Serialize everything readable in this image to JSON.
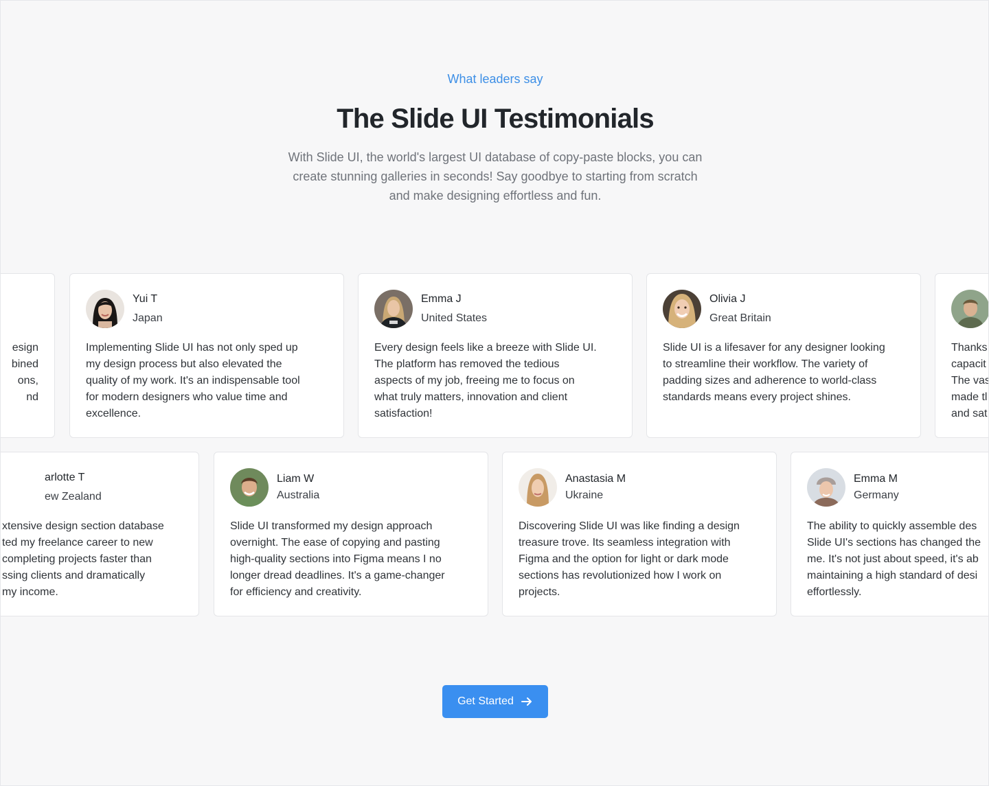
{
  "header": {
    "eyebrow": "What leaders say",
    "title": "The Slide UI Testimonials",
    "subtitle_lines": [
      "With Slide UI, the world's largest UI database of copy-paste blocks, you can",
      "create stunning galleries in seconds! Say goodbye to starting from scratch",
      "and make designing effortless and fun."
    ]
  },
  "row1": [
    {
      "name": "",
      "location": "",
      "avatar": "hidden",
      "lines": [
        "esign",
        "bined",
        "ons,",
        "nd"
      ]
    },
    {
      "name": "Yui T",
      "location": "Japan",
      "avatar": "woman-dark-hair",
      "lines": [
        "Implementing Slide UI has not only sped up",
        "my design process but also elevated the",
        "quality of my work. It's an indispensable tool",
        "for modern designers who value time and",
        "excellence."
      ]
    },
    {
      "name": "Emma J",
      "location": "United States",
      "avatar": "woman-blonde-tshirt",
      "lines": [
        "Every design feels like a breeze with Slide UI.",
        "The platform has removed the tedious",
        "aspects of my job, freeing me to focus on",
        "what truly matters, innovation and client",
        "satisfaction!"
      ]
    },
    {
      "name": "Olivia J",
      "location": "Great Britain",
      "avatar": "woman-blonde-smiling",
      "lines": [
        "Slide UI is a lifesaver for any designer looking",
        "to streamline their workflow. The variety of",
        "padding sizes and adherence to world-class",
        "standards means every project shines."
      ]
    },
    {
      "name": "",
      "location": "",
      "avatar": "man-outdoor",
      "lines": [
        "Thanks",
        "capacit",
        "The vas",
        "made tl",
        "and sat"
      ]
    }
  ],
  "row2": [
    {
      "name": "arlotte T",
      "location": "ew Zealand",
      "avatar": "hidden",
      "lines": [
        "xtensive design section database",
        "ted my freelance career to new",
        " completing projects faster than",
        "ssing clients and dramatically",
        "my income."
      ]
    },
    {
      "name": "Liam W",
      "location": "Australia",
      "avatar": "man-smiling",
      "lines": [
        "Slide UI transformed my design approach",
        "overnight. The ease of copying and pasting",
        "high-quality sections into Figma means I no",
        "longer dread deadlines. It's a game-changer",
        "for efficiency and creativity."
      ]
    },
    {
      "name": "Anastasia M",
      "location": "Ukraine",
      "avatar": "woman-light-hair",
      "lines": [
        "Discovering Slide UI was like finding a design",
        "treasure trove. Its seamless integration with",
        "Figma and the option for light or dark mode",
        "sections has revolutionized how I work on",
        "projects."
      ]
    },
    {
      "name": "Emma M",
      "location": "Germany",
      "avatar": "woman-beanie",
      "lines": [
        "The ability to quickly assemble des",
        "Slide UI's sections has changed the",
        "me. It's not just about speed, it's ab",
        "maintaining a high standard of desi",
        "effortlessly."
      ]
    }
  ],
  "cta": {
    "label": "Get Started",
    "icon": "arrow-right-icon"
  }
}
